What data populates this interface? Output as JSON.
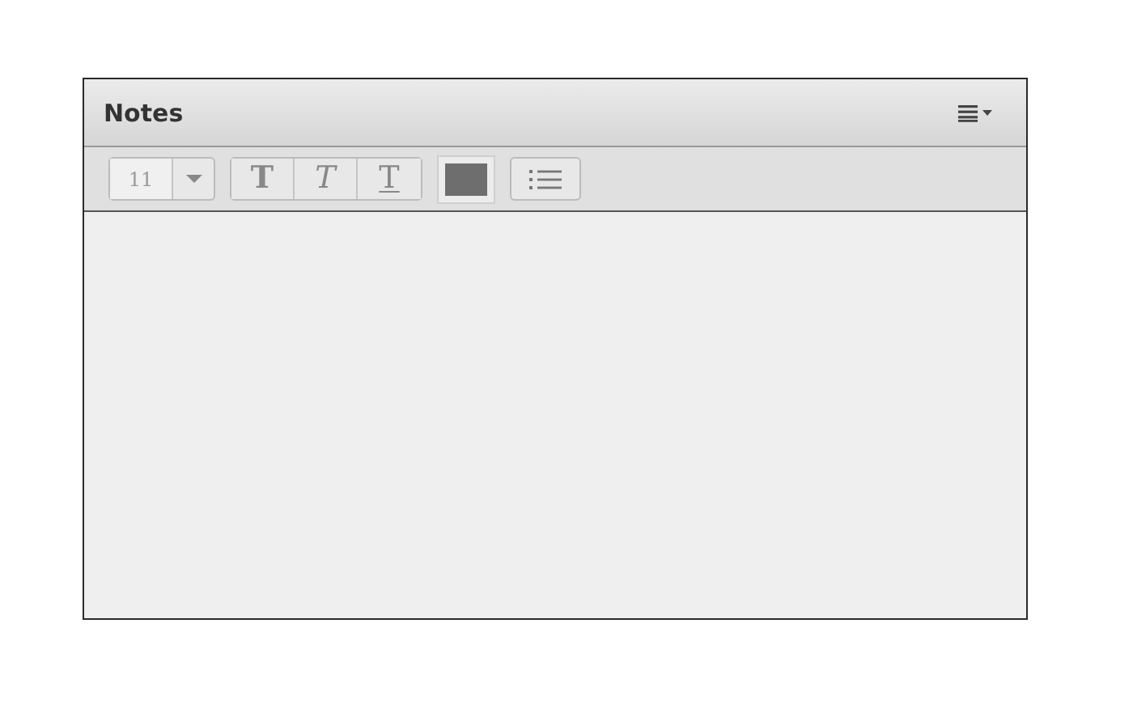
{
  "panel": {
    "title": "Notes"
  },
  "toolbar": {
    "font_size": "11",
    "styles": [
      {
        "kind": "bold",
        "glyph": "T"
      },
      {
        "kind": "italic",
        "glyph": "T"
      },
      {
        "kind": "underline",
        "glyph": "T"
      }
    ]
  }
}
